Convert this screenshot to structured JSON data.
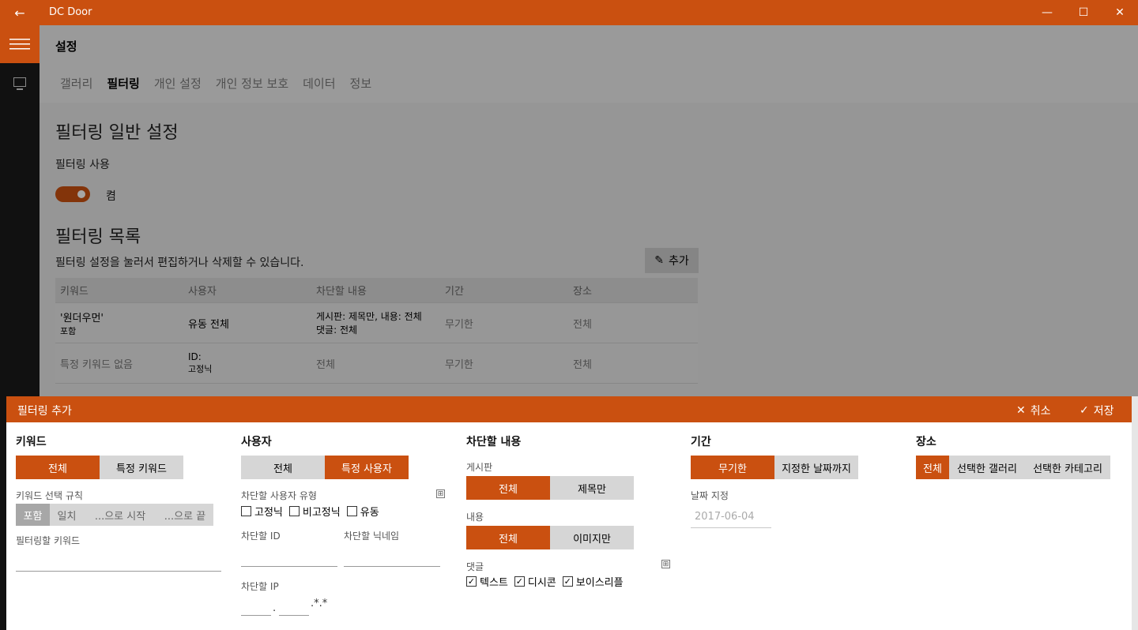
{
  "window": {
    "title": "DC Door",
    "back": "←",
    "minimize": "—",
    "maximize": "☐",
    "close": "✕"
  },
  "page": {
    "title": "설정"
  },
  "tabs": [
    "갤러리",
    "필터링",
    "개인 설정",
    "개인 정보 보호",
    "데이터",
    "정보"
  ],
  "general": {
    "heading": "필터링 일반 설정",
    "use_label": "필터링 사용",
    "toggle_state": "켬"
  },
  "list": {
    "heading": "필터링 목록",
    "description": "필터링 설정을 눌러서 편집하거나 삭제할 수 있습니다.",
    "add_label": "추가",
    "columns": [
      "키워드",
      "사용자",
      "차단할 내용",
      "기간",
      "장소"
    ],
    "rows": [
      {
        "keyword": "'원더우먼'",
        "keyword_sub": "포함",
        "user": "유동 전체",
        "user_sub": "",
        "content": "게시판: 제목만, 내용: 전체",
        "content_sub": "댓글: 전체",
        "period": "무기한",
        "place": "전체"
      },
      {
        "keyword": "특정 키워드 없음",
        "keyword_sub": "",
        "user": "ID:",
        "user_sub": "고정닉",
        "content": "전체",
        "content_sub": "",
        "period": "무기한",
        "place": "전체"
      }
    ]
  },
  "panel": {
    "title": "필터링 추가",
    "cancel": "취소",
    "save": "저장",
    "keyword": {
      "heading": "키워드",
      "options": [
        "전체",
        "특정 키워드"
      ],
      "rule_label": "키워드 선택 규칙",
      "rules": [
        "포함",
        "일치",
        "...으로 시작",
        "...으로 끝"
      ],
      "input_label": "필터링할 키워드"
    },
    "user": {
      "heading": "사용자",
      "options": [
        "전체",
        "특정 사용자"
      ],
      "type_label": "차단할 사용자 유형",
      "types": [
        "고정닉",
        "비고정닉",
        "유동"
      ],
      "id_label": "차단할 ID",
      "nick_label": "차단할 닉네임",
      "ip_label": "차단할 IP",
      "ip_suffix": ".*.*"
    },
    "content": {
      "heading": "차단할 내용",
      "board_label": "게시판",
      "board_options": [
        "전체",
        "제목만"
      ],
      "body_label": "내용",
      "body_options": [
        "전체",
        "이미지만"
      ],
      "comment_label": "댓글",
      "comment_types": [
        "텍스트",
        "디시콘",
        "보이스리플"
      ]
    },
    "period": {
      "heading": "기간",
      "options": [
        "무기한",
        "지정한 날짜까지"
      ],
      "date_label": "날짜 지정",
      "date_value": "2017-06-04"
    },
    "place": {
      "heading": "장소",
      "options": [
        "전체",
        "선택한 갤러리",
        "선택한 카테고리"
      ]
    }
  },
  "colors": {
    "accent": "#ca5010"
  }
}
